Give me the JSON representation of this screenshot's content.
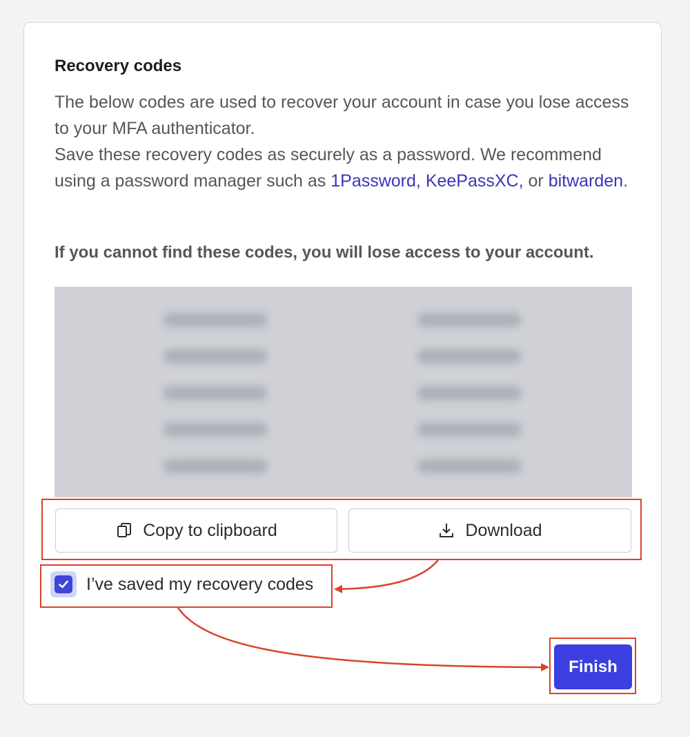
{
  "dialog": {
    "title": "Recovery codes",
    "description_line1": "The below codes are used to recover your account in case you lose access to your MFA authenticator.",
    "description_line2_prefix": "Save these recovery codes as securely as a password. We recommend using a password manager such as ",
    "link_1password": "1Password,",
    "link_keepassxc": "KeePassXC,",
    "description_or": " or ",
    "link_bitwarden": "bitwarden",
    "description_end": ".",
    "warning": "If you cannot find these codes, you will lose access to your account."
  },
  "codes_panel": {
    "state": "blurred",
    "columns": 2,
    "rows": 5
  },
  "actions": {
    "copy_label": "Copy to clipboard",
    "copy_icon": "clipboard-icon",
    "download_label": "Download",
    "download_icon": "download-icon"
  },
  "confirmation": {
    "label": "I’ve saved my recovery codes",
    "checked": true
  },
  "finish": {
    "label": "Finish"
  },
  "annotation": {
    "highlight_color": "#d9432a"
  },
  "colors": {
    "accent": "#3b3fe0",
    "link": "#3a35b8",
    "codes_background": "#cfd1d7"
  }
}
